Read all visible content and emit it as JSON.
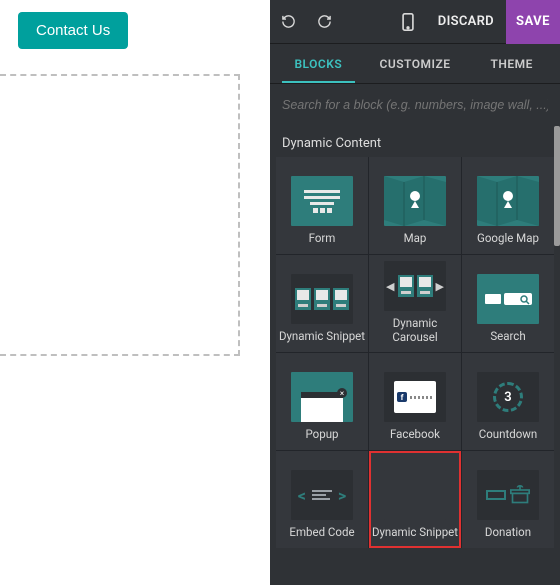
{
  "left": {
    "contact_label": "Contact Us"
  },
  "topbar": {
    "discard": "DISCARD",
    "save": "SAVE"
  },
  "tabs": {
    "blocks": "BLOCKS",
    "customize": "CUSTOMIZE",
    "theme": "THEME"
  },
  "search": {
    "placeholder": "Search for a block (e.g. numbers, image wall, ...)"
  },
  "section": {
    "title": "Dynamic Content"
  },
  "blocks": {
    "form": "Form",
    "map": "Map",
    "google_map": "Google Map",
    "dynamic_snippet": "Dynamic Snippet",
    "dynamic_carousel": "Dynamic Carousel",
    "search": "Search",
    "popup": "Popup",
    "facebook": "Facebook",
    "countdown": "Countdown",
    "countdown_value": "3",
    "embed_code": "Embed Code",
    "dynamic_snippet_2": "Dynamic Snippet",
    "donation": "Donation"
  }
}
